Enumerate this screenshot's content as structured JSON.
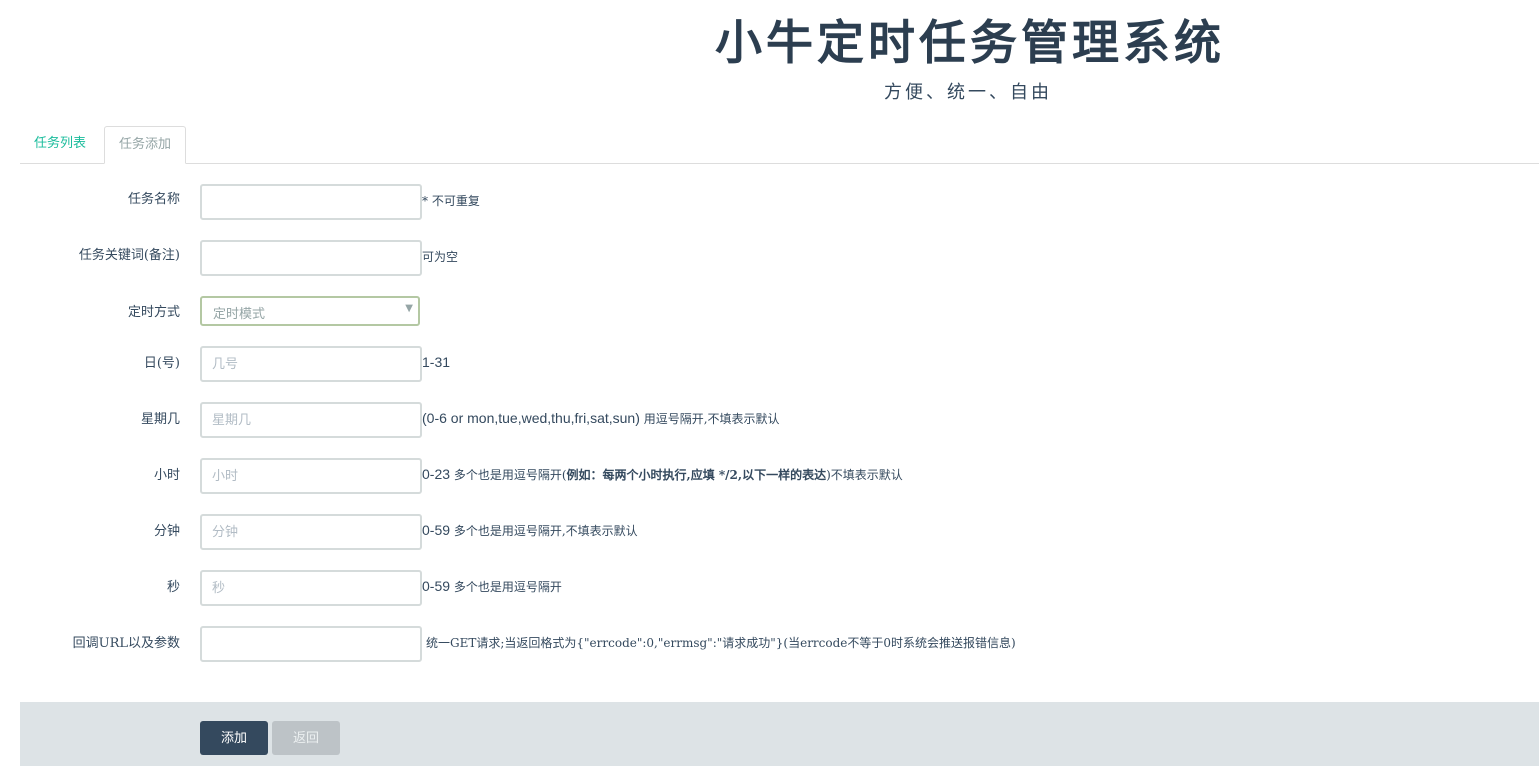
{
  "header": {
    "title": "小牛定时任务管理系统",
    "subtitle": "方便、统一、自由"
  },
  "tabs": [
    {
      "label": "任务列表",
      "active": false
    },
    {
      "label": "任务添加",
      "active": true
    }
  ],
  "form": {
    "task_name": {
      "label": "任务名称",
      "value": "",
      "placeholder": "",
      "hint": "* 不可重复"
    },
    "task_keyword": {
      "label": "任务关键词(备注)",
      "value": "",
      "placeholder": "",
      "hint": "可为空"
    },
    "schedule_mode": {
      "label": "定时方式",
      "selected": "定时模式"
    },
    "day": {
      "label": "日(号)",
      "value": "",
      "placeholder": "几号",
      "hint": "1-31"
    },
    "weekday": {
      "label": "星期几",
      "value": "",
      "placeholder": "星期几",
      "hint_range": "(0-6 or mon,tue,wed,thu,fri,sat,sun)",
      "hint_text": " 用逗号隔开,不填表示默认"
    },
    "hour": {
      "label": "小时",
      "value": "",
      "placeholder": "小时",
      "hint_range": "0-23",
      "hint_text1": " 多个也是用逗号隔开(",
      "hint_bold": "例如：每两个小时执行,应填 */2,以下一样的表达",
      "hint_text2": ")不填表示默认"
    },
    "minute": {
      "label": "分钟",
      "value": "",
      "placeholder": "分钟",
      "hint_range": "0-59",
      "hint_text": " 多个也是用逗号隔开,不填表示默认"
    },
    "second": {
      "label": "秒",
      "value": "",
      "placeholder": "秒",
      "hint_range": "0-59",
      "hint_text": " 多个也是用逗号隔开"
    },
    "callback": {
      "label": "回调URL以及参数",
      "value": "",
      "placeholder": "",
      "hint": " 统一GET请求;当返回格式为{\"errcode\":0,\"errmsg\":\"请求成功\"}(当errcode不等于0时系统会推送报错信息)"
    }
  },
  "buttons": {
    "add_label": "添加",
    "back_label": "返回"
  }
}
